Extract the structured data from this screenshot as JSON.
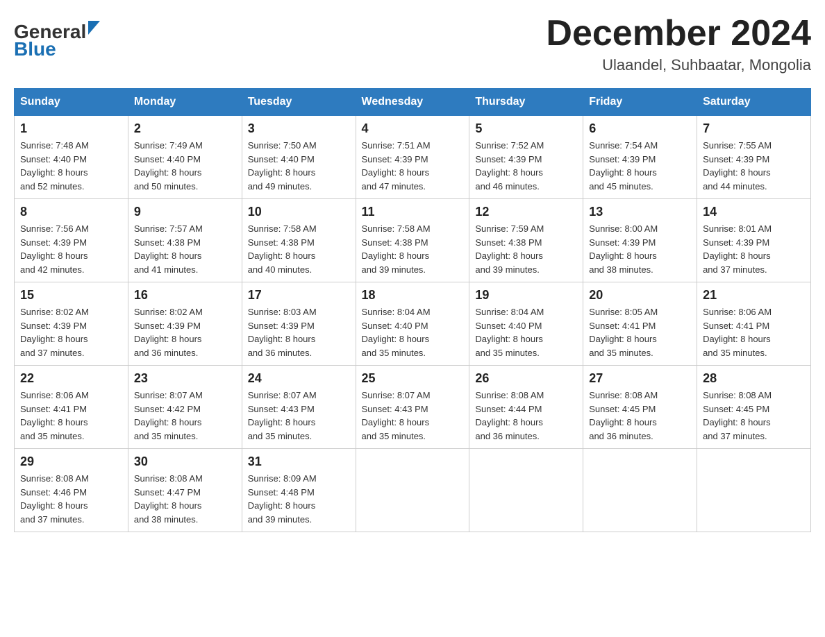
{
  "logo": {
    "line1": "General",
    "line2": "Blue"
  },
  "header": {
    "month": "December 2024",
    "location": "Ulaandel, Suhbaatar, Mongolia"
  },
  "days_header": [
    "Sunday",
    "Monday",
    "Tuesday",
    "Wednesday",
    "Thursday",
    "Friday",
    "Saturday"
  ],
  "weeks": [
    [
      {
        "day": "1",
        "sunrise": "7:48 AM",
        "sunset": "4:40 PM",
        "daylight": "8 hours and 52 minutes."
      },
      {
        "day": "2",
        "sunrise": "7:49 AM",
        "sunset": "4:40 PM",
        "daylight": "8 hours and 50 minutes."
      },
      {
        "day": "3",
        "sunrise": "7:50 AM",
        "sunset": "4:40 PM",
        "daylight": "8 hours and 49 minutes."
      },
      {
        "day": "4",
        "sunrise": "7:51 AM",
        "sunset": "4:39 PM",
        "daylight": "8 hours and 47 minutes."
      },
      {
        "day": "5",
        "sunrise": "7:52 AM",
        "sunset": "4:39 PM",
        "daylight": "8 hours and 46 minutes."
      },
      {
        "day": "6",
        "sunrise": "7:54 AM",
        "sunset": "4:39 PM",
        "daylight": "8 hours and 45 minutes."
      },
      {
        "day": "7",
        "sunrise": "7:55 AM",
        "sunset": "4:39 PM",
        "daylight": "8 hours and 44 minutes."
      }
    ],
    [
      {
        "day": "8",
        "sunrise": "7:56 AM",
        "sunset": "4:39 PM",
        "daylight": "8 hours and 42 minutes."
      },
      {
        "day": "9",
        "sunrise": "7:57 AM",
        "sunset": "4:38 PM",
        "daylight": "8 hours and 41 minutes."
      },
      {
        "day": "10",
        "sunrise": "7:58 AM",
        "sunset": "4:38 PM",
        "daylight": "8 hours and 40 minutes."
      },
      {
        "day": "11",
        "sunrise": "7:58 AM",
        "sunset": "4:38 PM",
        "daylight": "8 hours and 39 minutes."
      },
      {
        "day": "12",
        "sunrise": "7:59 AM",
        "sunset": "4:38 PM",
        "daylight": "8 hours and 39 minutes."
      },
      {
        "day": "13",
        "sunrise": "8:00 AM",
        "sunset": "4:39 PM",
        "daylight": "8 hours and 38 minutes."
      },
      {
        "day": "14",
        "sunrise": "8:01 AM",
        "sunset": "4:39 PM",
        "daylight": "8 hours and 37 minutes."
      }
    ],
    [
      {
        "day": "15",
        "sunrise": "8:02 AM",
        "sunset": "4:39 PM",
        "daylight": "8 hours and 37 minutes."
      },
      {
        "day": "16",
        "sunrise": "8:02 AM",
        "sunset": "4:39 PM",
        "daylight": "8 hours and 36 minutes."
      },
      {
        "day": "17",
        "sunrise": "8:03 AM",
        "sunset": "4:39 PM",
        "daylight": "8 hours and 36 minutes."
      },
      {
        "day": "18",
        "sunrise": "8:04 AM",
        "sunset": "4:40 PM",
        "daylight": "8 hours and 35 minutes."
      },
      {
        "day": "19",
        "sunrise": "8:04 AM",
        "sunset": "4:40 PM",
        "daylight": "8 hours and 35 minutes."
      },
      {
        "day": "20",
        "sunrise": "8:05 AM",
        "sunset": "4:41 PM",
        "daylight": "8 hours and 35 minutes."
      },
      {
        "day": "21",
        "sunrise": "8:06 AM",
        "sunset": "4:41 PM",
        "daylight": "8 hours and 35 minutes."
      }
    ],
    [
      {
        "day": "22",
        "sunrise": "8:06 AM",
        "sunset": "4:41 PM",
        "daylight": "8 hours and 35 minutes."
      },
      {
        "day": "23",
        "sunrise": "8:07 AM",
        "sunset": "4:42 PM",
        "daylight": "8 hours and 35 minutes."
      },
      {
        "day": "24",
        "sunrise": "8:07 AM",
        "sunset": "4:43 PM",
        "daylight": "8 hours and 35 minutes."
      },
      {
        "day": "25",
        "sunrise": "8:07 AM",
        "sunset": "4:43 PM",
        "daylight": "8 hours and 35 minutes."
      },
      {
        "day": "26",
        "sunrise": "8:08 AM",
        "sunset": "4:44 PM",
        "daylight": "8 hours and 36 minutes."
      },
      {
        "day": "27",
        "sunrise": "8:08 AM",
        "sunset": "4:45 PM",
        "daylight": "8 hours and 36 minutes."
      },
      {
        "day": "28",
        "sunrise": "8:08 AM",
        "sunset": "4:45 PM",
        "daylight": "8 hours and 37 minutes."
      }
    ],
    [
      {
        "day": "29",
        "sunrise": "8:08 AM",
        "sunset": "4:46 PM",
        "daylight": "8 hours and 37 minutes."
      },
      {
        "day": "30",
        "sunrise": "8:08 AM",
        "sunset": "4:47 PM",
        "daylight": "8 hours and 38 minutes."
      },
      {
        "day": "31",
        "sunrise": "8:09 AM",
        "sunset": "4:48 PM",
        "daylight": "8 hours and 39 minutes."
      },
      null,
      null,
      null,
      null
    ]
  ],
  "labels": {
    "sunrise": "Sunrise:",
    "sunset": "Sunset:",
    "daylight": "Daylight:"
  }
}
